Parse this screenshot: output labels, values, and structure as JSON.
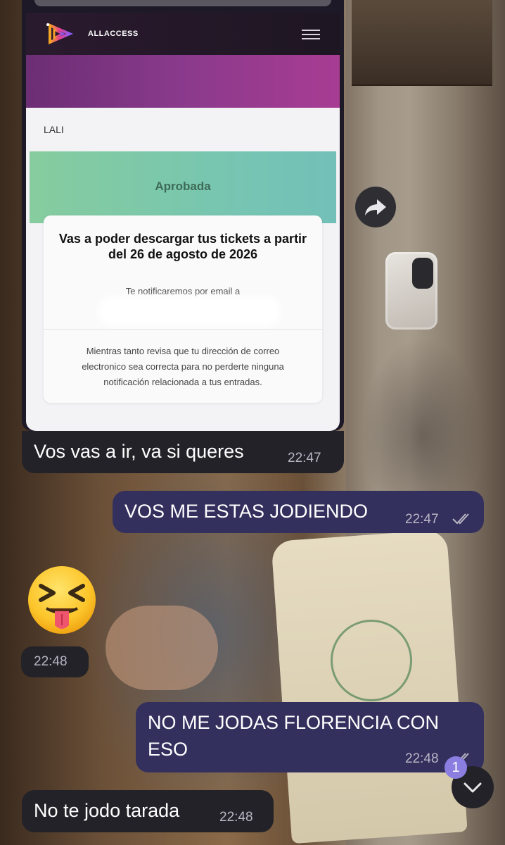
{
  "embedded_screenshot": {
    "brand": "ALLACCESS",
    "artist": "LALI",
    "status": "Aprobada",
    "title": "Vas a poder descargar tus tickets a partir del 26 de agosto de 2026",
    "notify_text": "Te notificaremos por email a",
    "note": "Mientras tanto revisa que tu dirección de correo electronico sea correcta para no perderte ninguna notificación relacionada a tus entradas."
  },
  "messages": [
    {
      "side": "in",
      "text": "Vos vas a ir, va si queres",
      "time": "22:47"
    },
    {
      "side": "out",
      "text": "VOS ME ESTAS JODIENDO",
      "time": "22:47",
      "status": "read"
    },
    {
      "side": "in",
      "emoji": "squinting-face-with-tongue",
      "time": "22:48"
    },
    {
      "side": "out",
      "text_line1": "NO ME JODAS FLORENCIA CON",
      "text_line2": "ESO",
      "time": "22:48",
      "status": "read"
    },
    {
      "side": "in",
      "text": "No te jodo tarada",
      "time": "22:48"
    }
  ],
  "scroll_down": {
    "unread_count": "1"
  },
  "colors": {
    "incoming": "#232228",
    "outgoing": "#33305e",
    "badge": "#8a7fe0"
  },
  "icons": [
    "forward-icon",
    "chevron-down-icon",
    "double-check-icon",
    "hamburger-menu-icon",
    "allaccess-logo"
  ]
}
